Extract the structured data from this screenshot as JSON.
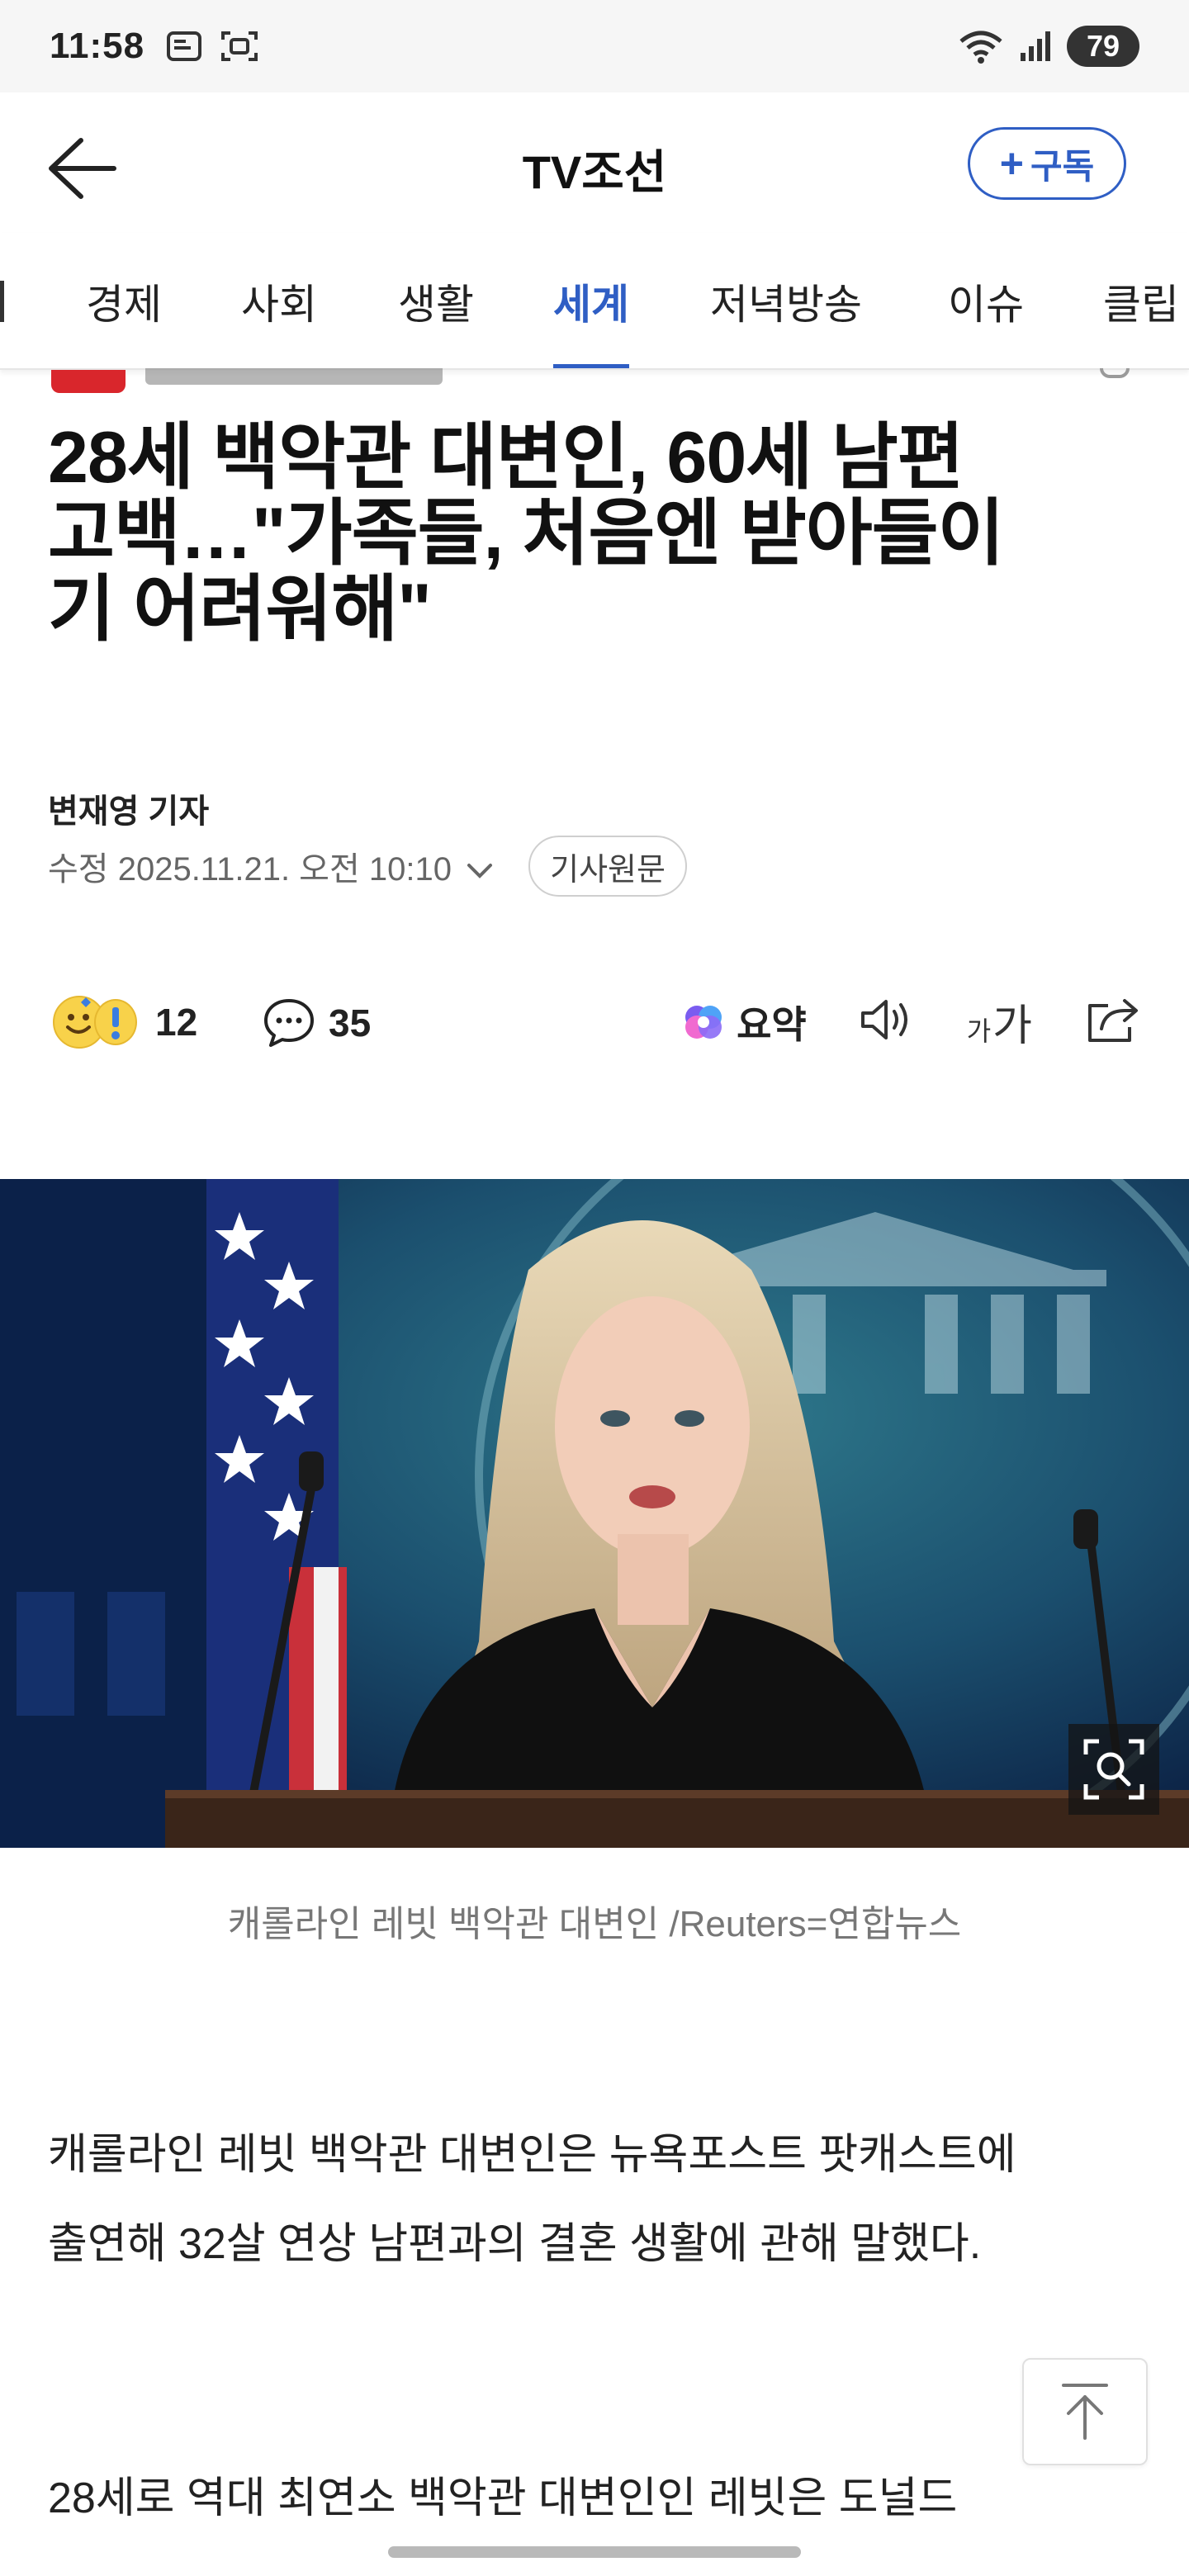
{
  "status_bar": {
    "time": "11:58",
    "battery": "79"
  },
  "header": {
    "title": "TV조선",
    "subscribe_label": "구독"
  },
  "tabs": [
    {
      "label": "경제",
      "active": false
    },
    {
      "label": "사회",
      "active": false
    },
    {
      "label": "생활",
      "active": false
    },
    {
      "label": "세계",
      "active": true
    },
    {
      "label": "저녁방송",
      "active": false
    },
    {
      "label": "이슈",
      "active": false
    },
    {
      "label": "클립",
      "active": false
    }
  ],
  "article": {
    "headline_lines": [
      "28세 백악관 대변인, 60세 남편",
      "고백…\"가족들, 처음엔 받아들이",
      "기 어려워해\""
    ],
    "byline": "변재영 기자",
    "modified": "수정 2025.11.21. 오전 10:10",
    "original_label": "기사원문",
    "reaction_count": "12",
    "comment_count": "35",
    "summary_label": "요약",
    "font_label_small": "가",
    "font_label_large": "가",
    "photo_caption": "캐롤라인 레빗 백악관 대변인 /Reuters=연합뉴스",
    "paragraph1": "캐롤라인 레빗 백악관 대변인은 뉴욕포스트 팟캐스트에 출연해 32살 연상 남편과의 결혼 생활에 관해 말했다.",
    "paragraph2": "28세로 역대 최연소 백악관 대변인인 레빗은 도널드"
  },
  "colors": {
    "accent": "#2f5ec4",
    "brand_red": "#d9262c",
    "text": "#111111",
    "muted": "#777777"
  }
}
